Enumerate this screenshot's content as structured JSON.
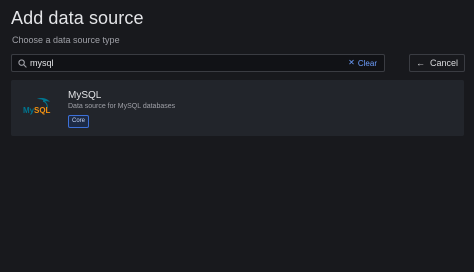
{
  "header": {
    "title": "Add data source",
    "subtitle": "Choose a data source type"
  },
  "search": {
    "value": "mysql",
    "placeholder": "",
    "clear_label": "Clear",
    "icon": "search-icon"
  },
  "cancel": {
    "label": "Cancel",
    "icon": "arrow-left-icon"
  },
  "results": [
    {
      "name": "MySQL",
      "description": "Data source for MySQL databases",
      "badge": "Core",
      "logo": "mysql-logo"
    }
  ],
  "colors": {
    "background": "#18191d",
    "card": "#22252b",
    "accent": "#6e9fff",
    "badge_border": "#3d71d9",
    "mysql_blue": "#00758f",
    "mysql_orange": "#f29111"
  }
}
